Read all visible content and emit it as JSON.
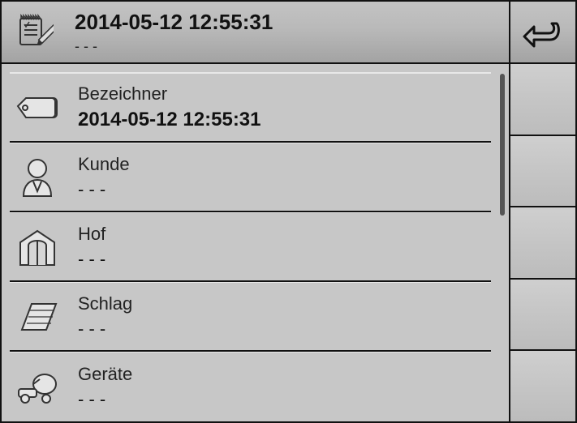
{
  "header": {
    "title": "2014-05-12 12:55:31",
    "sub": "- - -"
  },
  "rows": [
    {
      "label": "Bezeichner",
      "value": "2014-05-12 12:55:31",
      "placeholder": false,
      "icon": "tag"
    },
    {
      "label": "Kunde",
      "value": "- - -",
      "placeholder": true,
      "icon": "person"
    },
    {
      "label": "Hof",
      "value": "- - -",
      "placeholder": true,
      "icon": "barn"
    },
    {
      "label": "Schlag",
      "value": "- - -",
      "placeholder": true,
      "icon": "field"
    },
    {
      "label": "Geräte",
      "value": "- - -",
      "placeholder": true,
      "icon": "machine"
    }
  ]
}
